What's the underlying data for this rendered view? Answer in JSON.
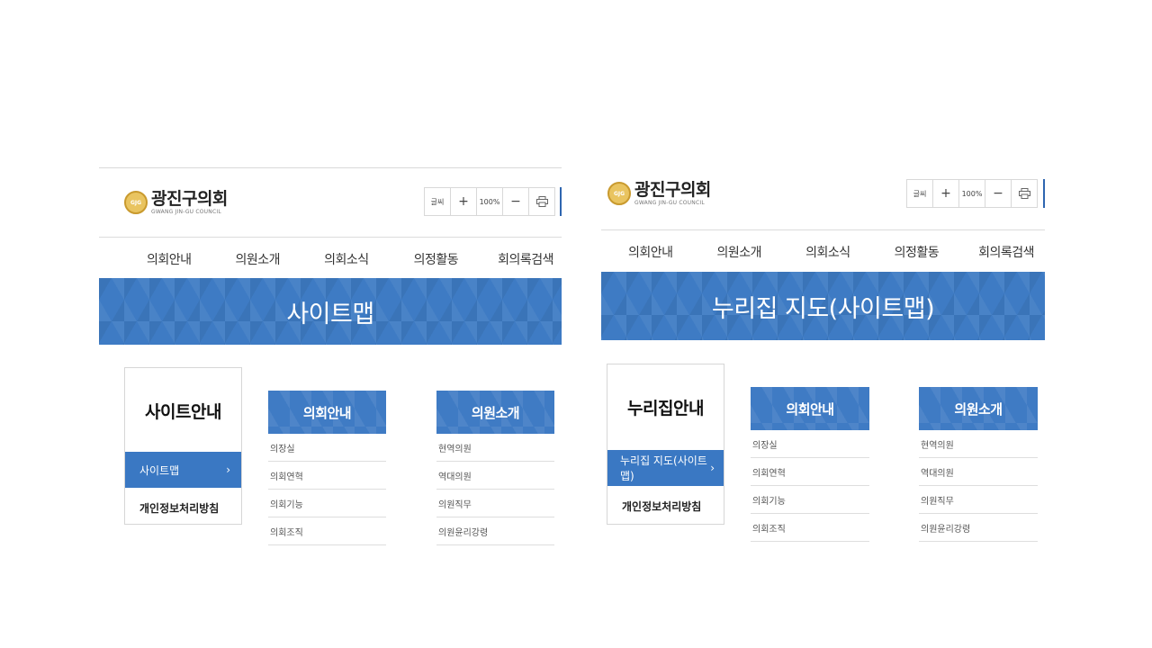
{
  "left": {
    "logo": {
      "name": "광진구의회",
      "name_en": "GWANG JIN-GU COUNCIL"
    },
    "toolbar": {
      "font_label": "글씨",
      "plus": "+",
      "zoom": "100%",
      "minus": "−",
      "print_icon": "print-icon"
    },
    "nav": [
      "의회안내",
      "의원소개",
      "의회소식",
      "의정활동",
      "회의록검색"
    ],
    "banner_title": "사이트맵",
    "side": {
      "title": "사이트안내",
      "active": "사이트맵",
      "chevron": "›",
      "item": "개인정보처리방침"
    },
    "columns": [
      {
        "header": "의회안내",
        "items": [
          "의장실",
          "의회연혁",
          "의회기능",
          "의회조직"
        ]
      },
      {
        "header": "의원소개",
        "items": [
          "현역의원",
          "역대의원",
          "의원직무",
          "의원윤리강령"
        ]
      }
    ]
  },
  "right": {
    "logo": {
      "name": "광진구의회",
      "name_en": "GWANG JIN-GU COUNCIL"
    },
    "toolbar": {
      "font_label": "글씨",
      "plus": "+",
      "zoom": "100%",
      "minus": "−",
      "print_icon": "print-icon"
    },
    "nav": [
      "의회안내",
      "의원소개",
      "의회소식",
      "의정활동",
      "회의록검색"
    ],
    "banner_title": "누리집 지도(사이트맵)",
    "side": {
      "title": "누리집안내",
      "active": "누리집 지도(사이트맵)",
      "chevron": "›",
      "item": "개인정보처리방침"
    },
    "columns": [
      {
        "header": "의회안내",
        "items": [
          "의장실",
          "의회연혁",
          "의회기능",
          "의회조직"
        ]
      },
      {
        "header": "의원소개",
        "items": [
          "현역의원",
          "역대의원",
          "의원직무",
          "의원윤리강령"
        ]
      }
    ]
  },
  "colors": {
    "accent": "#3e7bc4",
    "emblem": "#e9c460"
  }
}
